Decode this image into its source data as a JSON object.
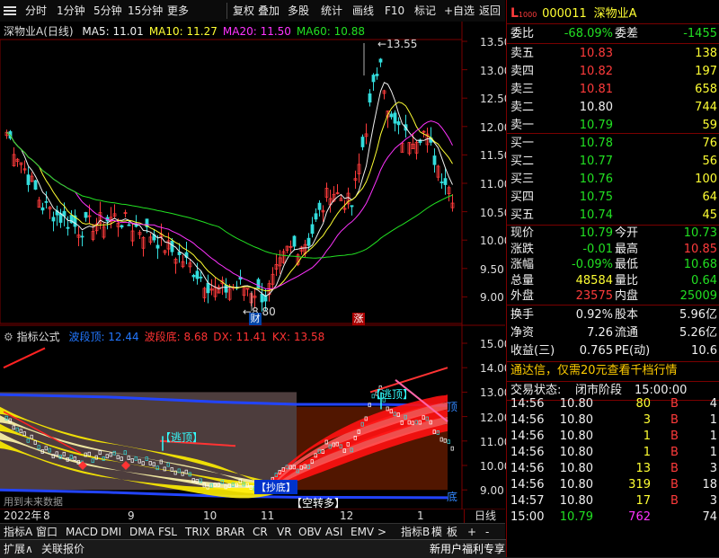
{
  "toolbar": {
    "items": [
      "分时",
      "1分钟",
      "5分钟",
      "15分钟",
      "更多",
      "复权",
      "叠加",
      "多股",
      "统计",
      "画线",
      "F10",
      "标记",
      "+自选",
      "返回"
    ]
  },
  "main_chart": {
    "title": "深物业A(日线)",
    "ma_labels": [
      "MA5: 11.01",
      "MA10: 11.27",
      "MA20: 11.50",
      "MA60: 10.88"
    ],
    "ma_colors": [
      "#f0f0f0",
      "#ffff33",
      "#ff33ff",
      "#22e022"
    ],
    "y_ticks": [
      "13.50",
      "13.00",
      "12.50",
      "12.00",
      "11.50",
      "11.00",
      "10.50",
      "10.00",
      "9.50",
      "9.00"
    ],
    "high_label": "13.55",
    "low_label": "8.80",
    "marker_cai": "财",
    "marker_zhang": "涨"
  },
  "indicator": {
    "title": "指标公式",
    "labels": [
      "波段顶: 12.44",
      "波段底: 8.68",
      "DX: 11.41",
      "KX: 13.58"
    ],
    "label_colors": [
      "#2277ff",
      "#ff3333",
      "#ff3333",
      "#ff3333"
    ],
    "y_ticks": [
      "15.00",
      "14.00",
      "13.00",
      "12.00",
      "11.00",
      "10.00",
      "9.00"
    ],
    "tags": {
      "escape_top_1": "【逃顶】",
      "escape_top_2": "【逃顶】",
      "bottom": "【抄底】",
      "short_to_long": "【空转多】",
      "ding": "顶",
      "di": "底"
    },
    "future_note": "用到未来数据"
  },
  "x_axis": {
    "labels": [
      "2022年",
      "8",
      "9",
      "10",
      "11",
      "12",
      "1"
    ],
    "period": "日线"
  },
  "tabs": [
    "指标A",
    "窗口",
    "MACD",
    "DMI",
    "DMA",
    "FSL",
    "TRIX",
    "BRAR",
    "CR",
    "VR",
    "OBV",
    "ASI",
    "EMV",
    ">",
    "指标B",
    "模",
    "板",
    "+",
    "-"
  ],
  "bottom_bar": {
    "left": [
      "扩展∧",
      "关联报价"
    ],
    "promo": "新用户福利专享",
    "icons": [
      "笔",
      "价",
      "细",
      "势",
      "联",
      "值",
      "主",
      "筹"
    ]
  },
  "quote": {
    "logo_letter": "L",
    "logo_sub": "1000",
    "code": "000011",
    "name": "深物业A",
    "webi_label": "委比",
    "webi_value": "-68.09%",
    "wecha_label": "委差",
    "wecha_value": "-1455",
    "asks": [
      {
        "label": "卖五",
        "price": "10.83",
        "vol": "138"
      },
      {
        "label": "卖四",
        "price": "10.82",
        "vol": "197"
      },
      {
        "label": "卖三",
        "price": "10.81",
        "vol": "658"
      },
      {
        "label": "卖二",
        "price": "10.80",
        "vol": "744"
      },
      {
        "label": "卖一",
        "price": "10.79",
        "vol": "59"
      }
    ],
    "bids": [
      {
        "label": "买一",
        "price": "10.78",
        "vol": "76"
      },
      {
        "label": "买二",
        "price": "10.77",
        "vol": "56"
      },
      {
        "label": "买三",
        "price": "10.76",
        "vol": "100"
      },
      {
        "label": "买四",
        "price": "10.75",
        "vol": "64"
      },
      {
        "label": "买五",
        "price": "10.74",
        "vol": "45"
      }
    ],
    "stats": [
      {
        "l1": "现价",
        "v1": "10.79",
        "l2": "今开",
        "v2": "10.73",
        "c1": "green",
        "c2": "green"
      },
      {
        "l1": "涨跌",
        "v1": "-0.01",
        "l2": "最高",
        "v2": "10.85",
        "c1": "green",
        "c2": "red"
      },
      {
        "l1": "涨幅",
        "v1": "-0.09%",
        "l2": "最低",
        "v2": "10.68",
        "c1": "green",
        "c2": "green"
      },
      {
        "l1": "总量",
        "v1": "48584",
        "l2": "量比",
        "v2": "0.64",
        "c1": "yellow",
        "c2": "green"
      },
      {
        "l1": "外盘",
        "v1": "23575",
        "l2": "内盘",
        "v2": "25009",
        "c1": "red",
        "c2": "green"
      }
    ],
    "stats2": [
      {
        "l1": "换手",
        "v1": "0.92%",
        "l2": "股本",
        "v2": "5.96亿"
      },
      {
        "l1": "净资",
        "v1": "7.26",
        "l2": "流通",
        "v2": "5.26亿"
      },
      {
        "l1": "收益(三)",
        "v1": "0.765",
        "l2": "PE(动)",
        "v2": "10.6"
      }
    ],
    "promo": "通达信，仅需20元查看千档行情",
    "status_label": "交易状态:",
    "status_value": "闭市阶段",
    "status_time": "15:00:00",
    "ticks": [
      {
        "time": "14:56",
        "price": "10.80",
        "vol": "80",
        "bs": "B",
        "n": "4"
      },
      {
        "time": "14:56",
        "price": "10.80",
        "vol": "3",
        "bs": "B",
        "n": "1"
      },
      {
        "time": "14:56",
        "price": "10.80",
        "vol": "1",
        "bs": "B",
        "n": "1"
      },
      {
        "time": "14:56",
        "price": "10.80",
        "vol": "1",
        "bs": "B",
        "n": "1"
      },
      {
        "time": "14:56",
        "price": "10.80",
        "vol": "13",
        "bs": "B",
        "n": "3"
      },
      {
        "time": "14:56",
        "price": "10.80",
        "vol": "319",
        "bs": "B",
        "n": "18"
      },
      {
        "time": "14:57",
        "price": "10.80",
        "vol": "17",
        "bs": "B",
        "n": "3"
      },
      {
        "time": "15:00",
        "price": "10.79",
        "vol": "762",
        "bs": "",
        "n": "74"
      }
    ]
  }
}
